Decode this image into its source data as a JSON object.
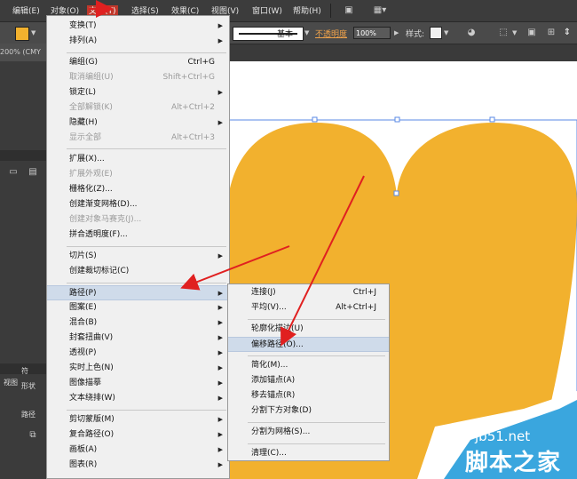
{
  "menubar": {
    "items": [
      "编辑(E)",
      "对象(O)",
      "文字(T)",
      "选择(S)",
      "效果(C)",
      "视图(V)",
      "窗口(W)",
      "帮助(H)"
    ]
  },
  "controlbar": {
    "stroke_style": "基本",
    "opacity_label": "不透明度",
    "opacity_value": "100%",
    "style_label": "样式:"
  },
  "document": {
    "zoom_tab": "200% (CMY"
  },
  "panels": {
    "tab1": "符",
    "tab2": "形状",
    "tab3": "路径",
    "tab4": "视图"
  },
  "object_menu": {
    "items": [
      {
        "label": "变换(T)",
        "shortcut": "",
        "submenu": true,
        "disabled": false
      },
      {
        "label": "排列(A)",
        "shortcut": "",
        "submenu": true,
        "disabled": false
      },
      {
        "label": "编组(G)",
        "shortcut": "Ctrl+G",
        "submenu": false,
        "disabled": false
      },
      {
        "label": "取消编组(U)",
        "shortcut": "Shift+Ctrl+G",
        "submenu": false,
        "disabled": true
      },
      {
        "label": "锁定(L)",
        "shortcut": "",
        "submenu": true,
        "disabled": false
      },
      {
        "label": "全部解锁(K)",
        "shortcut": "Alt+Ctrl+2",
        "submenu": false,
        "disabled": true
      },
      {
        "label": "隐藏(H)",
        "shortcut": "",
        "submenu": true,
        "disabled": false
      },
      {
        "label": "显示全部",
        "shortcut": "Alt+Ctrl+3",
        "submenu": false,
        "disabled": true
      },
      {
        "label": "扩展(X)...",
        "shortcut": "",
        "submenu": false,
        "disabled": false
      },
      {
        "label": "扩展外观(E)",
        "shortcut": "",
        "submenu": false,
        "disabled": true
      },
      {
        "label": "栅格化(Z)...",
        "shortcut": "",
        "submenu": false,
        "disabled": false
      },
      {
        "label": "创建渐变网格(D)...",
        "shortcut": "",
        "submenu": false,
        "disabled": false
      },
      {
        "label": "创建对象马赛克(J)...",
        "shortcut": "",
        "submenu": false,
        "disabled": true
      },
      {
        "label": "拼合透明度(F)...",
        "shortcut": "",
        "submenu": false,
        "disabled": false
      },
      {
        "label": "切片(S)",
        "shortcut": "",
        "submenu": true,
        "disabled": false
      },
      {
        "label": "创建裁切标记(C)",
        "shortcut": "",
        "submenu": false,
        "disabled": false
      },
      {
        "label": "路径(P)",
        "shortcut": "",
        "submenu": true,
        "disabled": false
      },
      {
        "label": "图案(E)",
        "shortcut": "",
        "submenu": true,
        "disabled": false
      },
      {
        "label": "混合(B)",
        "shortcut": "",
        "submenu": true,
        "disabled": false
      },
      {
        "label": "封套扭曲(V)",
        "shortcut": "",
        "submenu": true,
        "disabled": false
      },
      {
        "label": "透视(P)",
        "shortcut": "",
        "submenu": true,
        "disabled": false
      },
      {
        "label": "实时上色(N)",
        "shortcut": "",
        "submenu": true,
        "disabled": false
      },
      {
        "label": "图像描摹",
        "shortcut": "",
        "submenu": true,
        "disabled": false
      },
      {
        "label": "文本绕排(W)",
        "shortcut": "",
        "submenu": true,
        "disabled": false
      },
      {
        "label": "剪切蒙版(M)",
        "shortcut": "",
        "submenu": true,
        "disabled": false
      },
      {
        "label": "复合路径(O)",
        "shortcut": "",
        "submenu": true,
        "disabled": false
      },
      {
        "label": "画板(A)",
        "shortcut": "",
        "submenu": true,
        "disabled": false
      },
      {
        "label": "图表(R)",
        "shortcut": "",
        "submenu": true,
        "disabled": false
      }
    ]
  },
  "path_submenu": {
    "items": [
      {
        "label": "连接(J)",
        "shortcut": "Ctrl+J",
        "disabled": false
      },
      {
        "label": "平均(V)...",
        "shortcut": "Alt+Ctrl+J",
        "disabled": false
      },
      {
        "label": "轮廓化描边(U)",
        "shortcut": "",
        "disabled": false
      },
      {
        "label": "偏移路径(O)...",
        "shortcut": "",
        "disabled": false
      },
      {
        "label": "简化(M)...",
        "shortcut": "",
        "disabled": false
      },
      {
        "label": "添加锚点(A)",
        "shortcut": "",
        "disabled": false
      },
      {
        "label": "移去锚点(R)",
        "shortcut": "",
        "disabled": false
      },
      {
        "label": "分割下方对象(D)",
        "shortcut": "",
        "disabled": false
      },
      {
        "label": "分割为网格(S)...",
        "shortcut": "",
        "disabled": false
      },
      {
        "label": "清理(C)...",
        "shortcut": "",
        "disabled": false
      }
    ]
  },
  "watermark": {
    "site": "jb51.net",
    "name": "脚本之家"
  },
  "colors": {
    "heart": "#f2b12e",
    "highlight": "#cfdbea",
    "arrow": "#e02020",
    "watermark_blue": "#3aa6de"
  }
}
